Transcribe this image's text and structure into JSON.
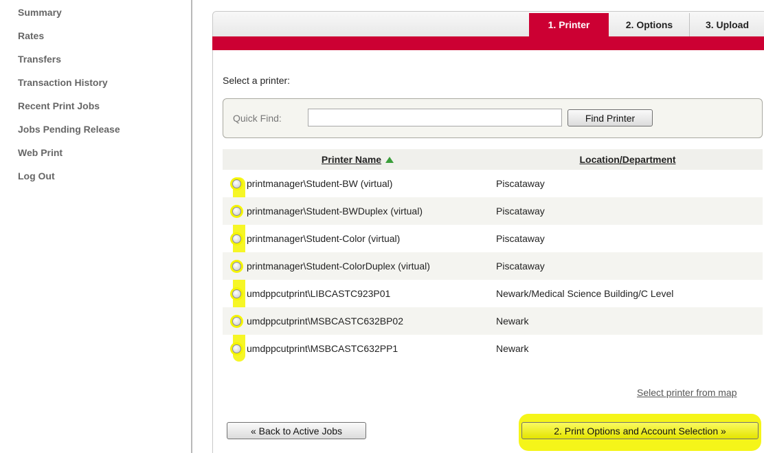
{
  "sidebar": {
    "items": [
      {
        "label": "Summary"
      },
      {
        "label": "Rates"
      },
      {
        "label": "Transfers"
      },
      {
        "label": "Transaction History"
      },
      {
        "label": "Recent Print Jobs"
      },
      {
        "label": "Jobs Pending Release"
      },
      {
        "label": "Web Print"
      },
      {
        "label": "Log Out"
      }
    ]
  },
  "tabs": [
    {
      "label": "1. Printer",
      "active": true
    },
    {
      "label": "2. Options",
      "active": false
    },
    {
      "label": "3. Upload",
      "active": false
    }
  ],
  "main": {
    "select_label": "Select a printer:",
    "quick_find": {
      "label": "Quick Find:",
      "value": "",
      "button_label": "Find Printer"
    },
    "table": {
      "headers": [
        "Printer Name",
        "Location/Department"
      ],
      "sort_column": "Printer Name",
      "sort_direction": "ascending",
      "rows": [
        {
          "name": "printmanager\\Student-BW (virtual)",
          "location": "Piscataway"
        },
        {
          "name": "printmanager\\Student-BWDuplex (virtual)",
          "location": "Piscataway"
        },
        {
          "name": "printmanager\\Student-Color (virtual)",
          "location": "Piscataway"
        },
        {
          "name": "printmanager\\Student-ColorDuplex (virtual)",
          "location": "Piscataway"
        },
        {
          "name": "umdppcutprint\\LIBCASTC923P01",
          "location": "Newark/Medical Science Building/C Level"
        },
        {
          "name": "umdppcutprint\\MSBCASTC632BP02",
          "location": "Newark"
        },
        {
          "name": "umdppcutprint\\MSBCASTC632PP1",
          "location": "Newark"
        }
      ]
    },
    "map_link": "Select printer from map",
    "back_button": "« Back to Active Jobs",
    "next_button": "2. Print Options and Account Selection »"
  },
  "colors": {
    "accent_red": "#cc0033",
    "highlight_yellow": "#f4f400",
    "sort_arrow_green": "#3a9e3a"
  }
}
